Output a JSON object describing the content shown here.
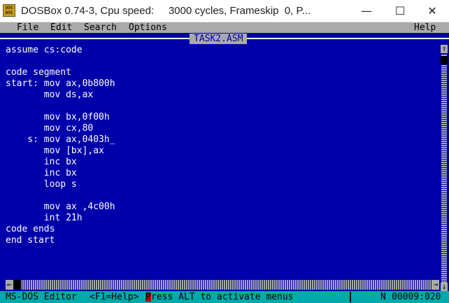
{
  "window": {
    "icon_text": "DOS BOX",
    "title": "DOSBox 0.74-3, Cpu speed:     3000 cycles, Frameskip  0, P...",
    "minimize_glyph": "—",
    "maximize_glyph": "☐",
    "close_glyph": "✕"
  },
  "menu": {
    "file": "File",
    "edit": "Edit",
    "search": "Search",
    "options": "Options",
    "help": "Help"
  },
  "editor": {
    "filename": "TASK2.ASM",
    "lines": [
      "assume cs:code",
      "",
      "code segment",
      "start: mov ax,0b800h",
      "       mov ds,ax",
      "",
      "       mov bx,0f00h",
      "       mov cx,80",
      "    s: mov ax,0403h_",
      "       mov [bx],ax",
      "       inc bx",
      "       inc bx",
      "       loop s",
      "",
      "       mov ax ,4c00h",
      "       int 21h",
      "code ends",
      "end start"
    ]
  },
  "scrollbar": {
    "up_arrow": "↑",
    "down_arrow": "↓",
    "left_arrow": "←",
    "right_arrow": "→"
  },
  "status": {
    "app_name": "MS-DOS Editor",
    "help_hint": "<F1=Help>",
    "message_first": "P",
    "message_rest": "ress ALT to activate menus",
    "mode": "N",
    "position": "00009:020"
  },
  "colors": {
    "background": "#0000aa",
    "text": "#ffffff",
    "menubar": "#aaaaaa",
    "statusbar": "#00aaaa",
    "cursor": "#aa0000"
  }
}
